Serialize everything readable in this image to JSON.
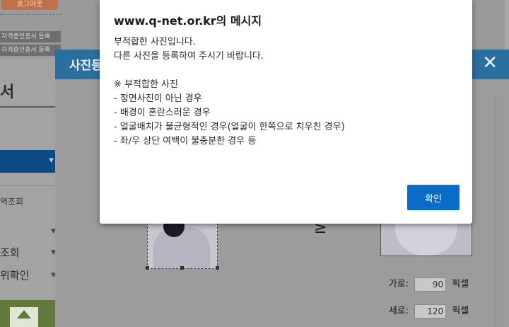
{
  "background_page": {
    "top_button": "로그아웃",
    "links": [
      "자격증인증서 등록",
      "자격증인증서 등록"
    ],
    "heading": "서",
    "nav_items": [
      "역조회",
      "조회",
      "위확인"
    ]
  },
  "photo_dialog": {
    "title": "사진등록",
    "close_label": "✕",
    "width_label": "가로:",
    "width_value": "90",
    "width_unit": "픽셀",
    "height_label": "세로:",
    "height_value": "120",
    "height_unit": "픽셀"
  },
  "alert": {
    "title": "www.q-net.or.kr의 메시지",
    "lines": [
      "부적합한 사진입니다.",
      "다른 사진을 등록하여 주시기 바랍니다."
    ],
    "notice_heading": "※ 부적합한 사진",
    "reasons": [
      "- 정면사진이 아닌 경우",
      "- 배경이 혼란스러운 경우",
      "- 얼굴배치가 불균형적인 경우(얼굴이 한쪽으로 치우친 경우)",
      "- 좌/우 상단 여백이 불충분한 경우 등"
    ],
    "ok_label": "확인"
  },
  "colors": {
    "ok_button": "#0a6cc8",
    "dialog_header": "#2a6f9e",
    "overlay": "#9a9a9a"
  }
}
